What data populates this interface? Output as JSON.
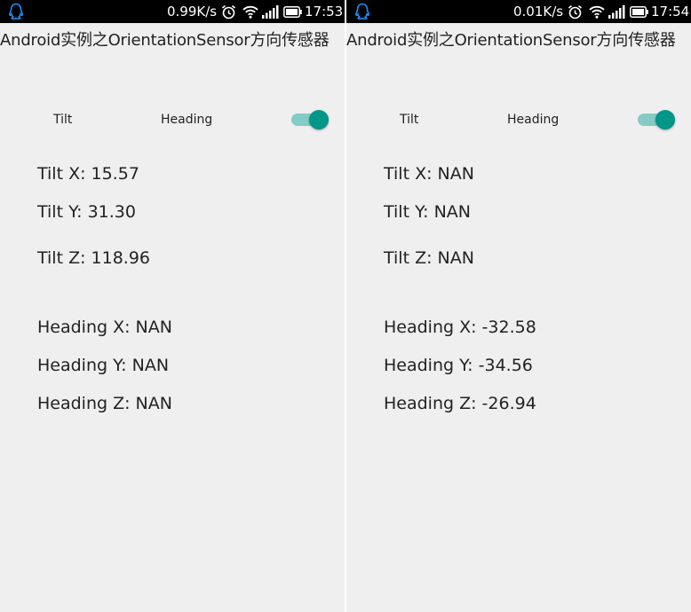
{
  "screens": [
    {
      "status": {
        "speed": "0.99K/s",
        "time": "17:53"
      },
      "title": "Android实例之OrientationSensor方向传感器",
      "tabs": {
        "tilt": "Tilt",
        "heading": "Heading"
      },
      "switch_on": true,
      "readings": {
        "tilt_x": "Tilt X: 15.57",
        "tilt_y": "Tilt Y: 31.30",
        "tilt_z": "Tilt Z: 118.96",
        "heading_x": "Heading X: NAN",
        "heading_y": "Heading Y: NAN",
        "heading_z": "Heading Z: NAN"
      }
    },
    {
      "status": {
        "speed": "0.01K/s",
        "time": "17:54"
      },
      "title": "Android实例之OrientationSensor方向传感器",
      "tabs": {
        "tilt": "Tilt",
        "heading": "Heading"
      },
      "switch_on": true,
      "readings": {
        "tilt_x": "Tilt X: NAN",
        "tilt_y": "Tilt Y: NAN",
        "tilt_z": "Tilt Z: NAN",
        "heading_x": "Heading X: -32.58",
        "heading_y": "Heading Y: -34.56",
        "heading_z": "Heading Z: -26.94"
      }
    }
  ],
  "colors": {
    "accent": "#009688",
    "track": "#84cbc5",
    "background": "#efefef",
    "statusbar": "#000000",
    "qq_icon": "#1f8ff3"
  },
  "icons": [
    "qq-icon",
    "alarm-icon",
    "wifi-icon",
    "signal-icon",
    "battery-icon"
  ]
}
